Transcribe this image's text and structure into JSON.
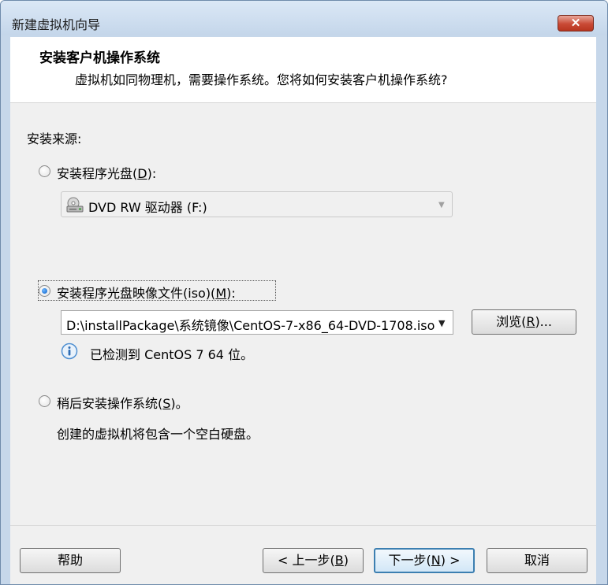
{
  "window": {
    "title": "新建虚拟机向导",
    "close_icon": "close-icon"
  },
  "header": {
    "title": "安装客户机操作系统",
    "subtitle": "虚拟机如同物理机，需要操作系统。您将如何安装客户机操作系统?"
  },
  "install_source": {
    "label": "安装来源:",
    "options": [
      {
        "pre": "安装程序光盘(",
        "key": "D",
        "post": "):",
        "selected": false
      },
      {
        "pre": "安装程序光盘映像文件(iso)(",
        "key": "M",
        "post": "):",
        "selected": true
      },
      {
        "pre": "稍后安装操作系统(",
        "key": "S",
        "post": ")。",
        "selected": false
      }
    ],
    "dvd_drive": {
      "value": "DVD RW 驱动器 (F:)",
      "icon": "dvd-drive-icon",
      "enabled": false
    },
    "iso_path": {
      "value": "D:\\installPackage\\系统镜像\\CentOS-7-x86_64-DVD-1708.iso"
    },
    "browse_button": {
      "pre": "浏览(",
      "key": "R",
      "post": ")..."
    },
    "detected": {
      "icon": "info-icon",
      "text": "已检测到 CentOS 7 64 位。"
    },
    "later_note": "创建的虚拟机将包含一个空白硬盘。"
  },
  "footer": {
    "help": "帮助",
    "back": {
      "pre": "< 上一步(",
      "key": "B",
      "post": ")"
    },
    "next": {
      "pre": "下一步(",
      "key": "N",
      "post": ") >"
    },
    "cancel": "取消"
  },
  "colors": {
    "frame": "#c6d7ea",
    "close_button": "#c94a36",
    "selected_radio": "#0b5fc7",
    "default_button_border": "#3c7fb1"
  }
}
